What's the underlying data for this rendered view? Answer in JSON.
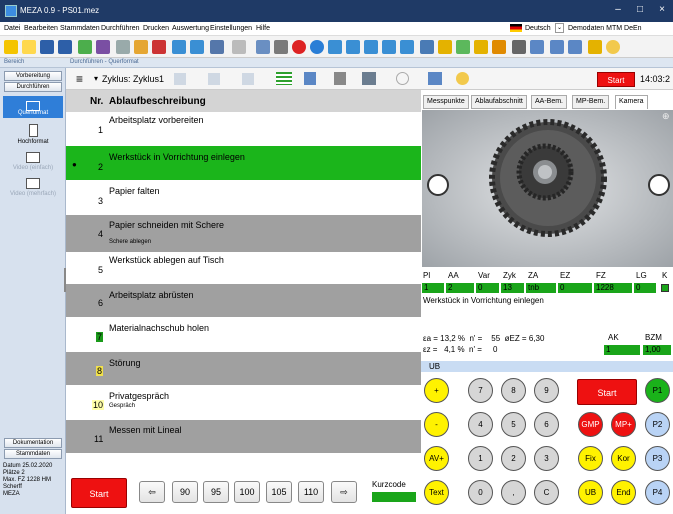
{
  "window": {
    "title": "MEZA 0.9 - PS01.mez",
    "minimize": "–",
    "maximize": "□",
    "close": "×"
  },
  "menu": [
    "Datei",
    "Bearbeiten",
    "Stammdaten",
    "Durchführen",
    "Drucken",
    "Auswertung",
    "Einstellungen",
    "Hilfe"
  ],
  "language": "Deutsch",
  "profile": "Demodaten MTM DeEn",
  "bereich": {
    "left": "Bereich",
    "right": "Durchführen - Querformat"
  },
  "left": {
    "btn_vorbereitung": "Vorbereitung",
    "btn_durchfuehren": "Durchführen",
    "modes": [
      "Querformat",
      "Hochformat",
      "Video (einfach)",
      "Video (mehrfach)"
    ],
    "btn_dokumentation": "Dokumentation",
    "btn_stammdaten": "Stammdaten",
    "info": [
      "Datum  25.02.2020",
      "Plätze  2",
      "Max. FZ  1228 HM",
      "Scherff",
      "MEZA"
    ]
  },
  "subtool": {
    "cycle_label": "Zyklus: Zyklus1",
    "start_label": "Start",
    "clock": "14:03:2"
  },
  "list": {
    "header_nr": "Nr.",
    "header_desc": "Ablaufbeschreibung",
    "rows": [
      {
        "nr": "1",
        "text": "Arbeitsplatz vorbereiten",
        "sub": ""
      },
      {
        "nr": "2",
        "text": "Werkstück in Vorrichtung einlegen",
        "sub": ""
      },
      {
        "nr": "3",
        "text": "Papier falten",
        "sub": ""
      },
      {
        "nr": "4",
        "text": "Papier schneiden mit Schere",
        "sub": "Schere ablegen"
      },
      {
        "nr": "5",
        "text": "Werkstück ablegen auf Tisch",
        "sub": ""
      },
      {
        "nr": "6",
        "text": "Arbeitsplatz abrüsten",
        "sub": ""
      },
      {
        "nr": "7",
        "text": "Materialnachschub holen",
        "sub": ""
      },
      {
        "nr": "8",
        "text": "Störung",
        "sub": ""
      },
      {
        "nr": "10",
        "text": "Privatgespräch",
        "sub": "Gespräch"
      },
      {
        "nr": "11",
        "text": "Messen mit Lineal",
        "sub": ""
      }
    ]
  },
  "bottom": {
    "start": "Start",
    "percent_buttons": [
      "90",
      "95",
      "100",
      "105",
      "110"
    ],
    "kurzcode": "Kurzcode"
  },
  "tabs": [
    "Messpunkte",
    "Ablaufabschnitt",
    "AA-Bem.",
    "MP-Bem.",
    "Kamera"
  ],
  "status": {
    "headers": [
      "Pl",
      "AA",
      "Var",
      "Zyk",
      "ZA",
      "EZ",
      "FZ",
      "LG",
      "K"
    ],
    "values": [
      "1",
      "2",
      "0",
      "13",
      "tnb",
      "0",
      "1228",
      "0"
    ],
    "current": "Werkstück in Vorrichtung einlegen",
    "stats1": "εa = 13,2 %  n' =    55  øEZ = 6,30",
    "stats2": "εz =   4,1 %  n' =     0",
    "ak_label": "AK",
    "ak_value": "1",
    "bzm_label": "BZM",
    "bzm_value": "1,00"
  },
  "ub": "UB",
  "keypad": {
    "plus": "+",
    "minus": "-",
    "avplus": "AV+",
    "text": "Text",
    "n7": "7",
    "n8": "8",
    "n9": "9",
    "n4": "4",
    "n5": "5",
    "n6": "6",
    "n1": "1",
    "n2": "2",
    "n3": "3",
    "n0": "0",
    "comma": ",",
    "c": "C",
    "start": "Start",
    "gmp": "GMP",
    "mpplus": "MP+",
    "fix": "Fix",
    "kor": "Kor",
    "ub": "UB",
    "end": "End",
    "p1": "P1",
    "p2": "P2",
    "p3": "P3",
    "p4": "P4"
  }
}
